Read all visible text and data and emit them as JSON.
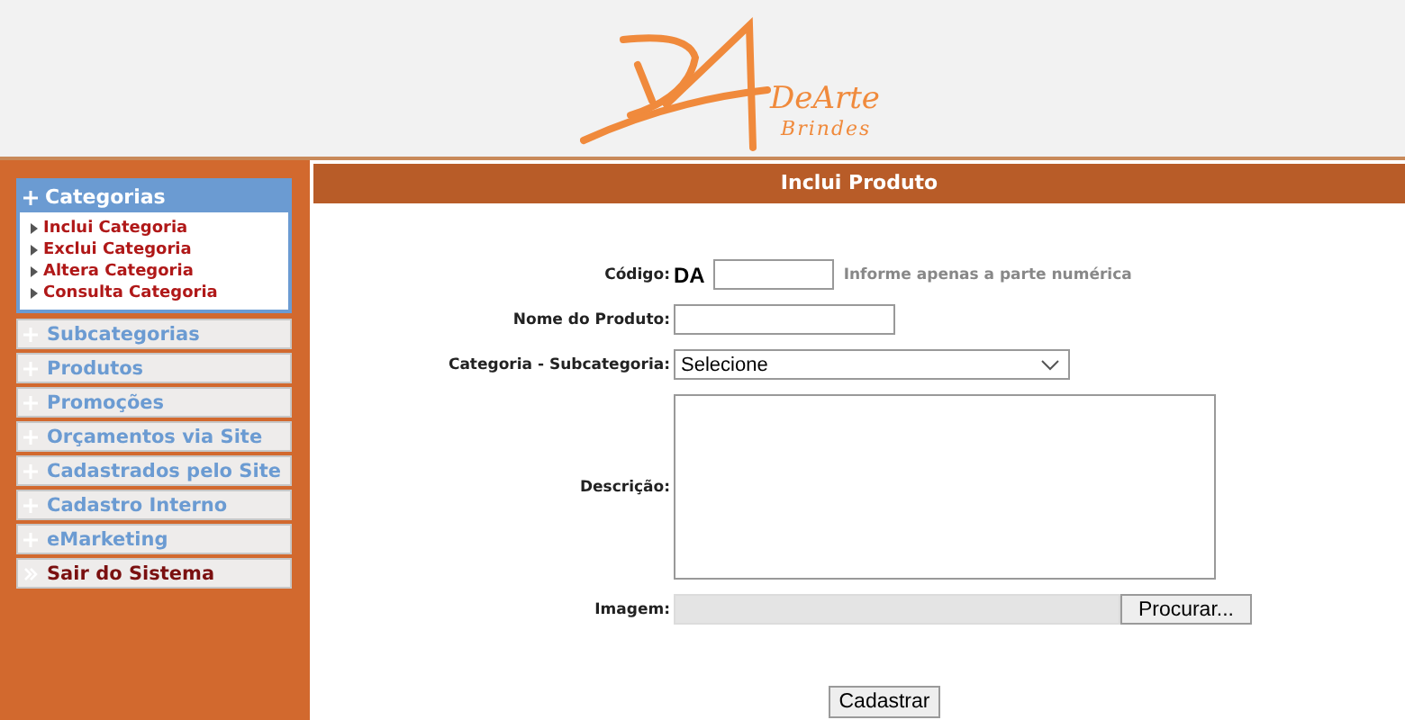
{
  "header": {
    "brand": "DeArte",
    "tagline": "Brindes"
  },
  "sidebar": {
    "items": [
      {
        "kind": "group",
        "label": "Categorias",
        "expanded": true,
        "children": [
          {
            "label": "Inclui Categoria"
          },
          {
            "label": "Exclui Categoria"
          },
          {
            "label": "Altera Categoria"
          },
          {
            "label": "Consulta Categoria"
          }
        ]
      },
      {
        "kind": "group",
        "label": "Subcategorias",
        "expanded": false
      },
      {
        "kind": "group",
        "label": "Produtos",
        "expanded": false
      },
      {
        "kind": "group",
        "label": "Promoções",
        "expanded": false
      },
      {
        "kind": "group",
        "label": "Orçamentos via Site",
        "expanded": false
      },
      {
        "kind": "group",
        "label": "Cadastrados pelo Site",
        "expanded": false
      },
      {
        "kind": "group",
        "label": "Cadastro Interno",
        "expanded": false
      },
      {
        "kind": "group",
        "label": "eMarketing",
        "expanded": false
      },
      {
        "kind": "link",
        "label": "Sair do Sistema"
      }
    ]
  },
  "form": {
    "title": "Inclui Produto",
    "fields": [
      {
        "kind": "code",
        "label": "Código:",
        "prefix": "DA",
        "hint": "Informe apenas a parte numérica"
      },
      {
        "kind": "text",
        "label": "Nome do Produto:"
      },
      {
        "kind": "select",
        "label": "Categoria - Subcategoria:",
        "value": "Selecione"
      },
      {
        "kind": "textarea",
        "label": "Descrição:"
      },
      {
        "kind": "file",
        "label": "Imagem:",
        "button": "Procurar..."
      }
    ],
    "submit": "Cadastrar"
  }
}
